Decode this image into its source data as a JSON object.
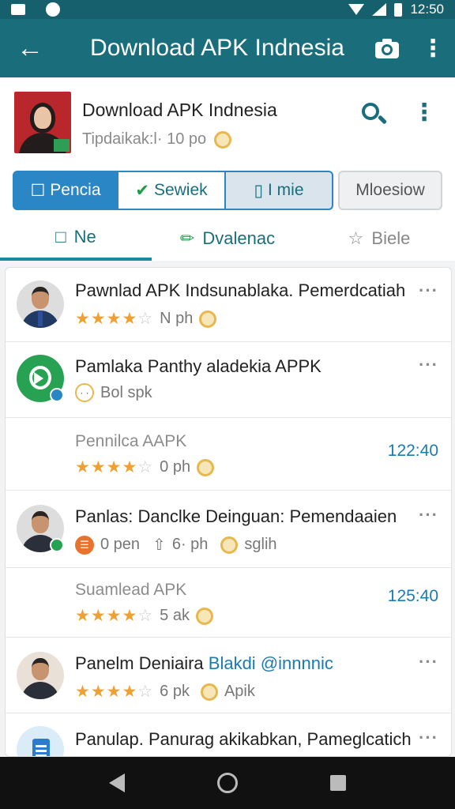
{
  "status_bar": {
    "time": "12:50"
  },
  "app_bar": {
    "title": "Download APK Indnesia"
  },
  "header": {
    "app_name": "Download APK Indnesia",
    "app_subtitle": "Tipdaikak:l· 10 po"
  },
  "segments": [
    {
      "label": "Pencia"
    },
    {
      "label": "Sewiek"
    },
    {
      "label": "I mie"
    },
    {
      "label": "Mloesiow"
    }
  ],
  "tabs": [
    {
      "label": "Ne"
    },
    {
      "label": "Dvalenac"
    },
    {
      "label": "Biele"
    }
  ],
  "rows": [
    {
      "title": "Pawnlad APK Indsunablaka. Pemerdcatiah",
      "meta_text": "N ph",
      "more": "···"
    },
    {
      "title": "Pamlaka Panthy aladekia APPK",
      "meta_text": "Bol spk",
      "more": "···"
    },
    {
      "title": "Pennilca AAPK",
      "meta_text": "0 ph",
      "time": "122:40"
    },
    {
      "title": "Panlas: Danclke Deinguan: Pemendaaien",
      "meta_a": "0 pen",
      "meta_b": "6· ph",
      "meta_c": "sglih",
      "more": "···"
    },
    {
      "title": "Suamlead APK",
      "meta_text": "5 ak",
      "time": "125:40"
    },
    {
      "title": "Panelm Deniaira",
      "title_highlight": "Blakdi @innnnic",
      "meta_a": "6 pk",
      "meta_c": "Apik",
      "more": "···"
    },
    {
      "title": "Panulap. Panurag akikabkan, Pameglcatich",
      "more": "···"
    }
  ],
  "colors": {
    "app_bar": "#1a6e7b",
    "accent_blue": "#2b86c5",
    "star": "#f0a030",
    "time": "#1a7bb0"
  }
}
